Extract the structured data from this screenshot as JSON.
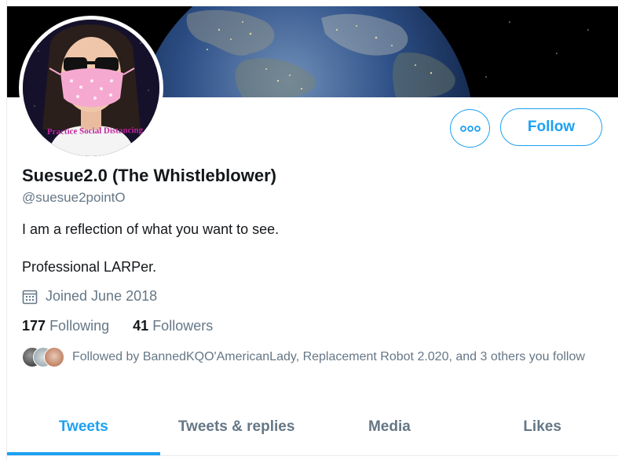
{
  "profile": {
    "name": "Suesue2.0 (The Whistleblower)",
    "handle": "@suesue2pointO",
    "bio_line1": "I am a reflection of what you want to see.",
    "bio_line2": "Professional LARPer.",
    "joined": "Joined June 2018",
    "avatar_caption": "Practice Social Distancing"
  },
  "stats": {
    "following_count": "177",
    "following_label": "Following",
    "followers_count": "41",
    "followers_label": "Followers"
  },
  "followed_by": {
    "text": "Followed by BannedKQO'AmericanLady, Replacement Robot 2.020, and 3 others you follow"
  },
  "actions": {
    "more_icon": "more-horizontal-icon",
    "follow_label": "Follow"
  },
  "tabs": [
    {
      "label": "Tweets",
      "active": true
    },
    {
      "label": "Tweets & replies",
      "active": false
    },
    {
      "label": "Media",
      "active": false
    },
    {
      "label": "Likes",
      "active": false
    }
  ],
  "colors": {
    "accent": "#1da1f2",
    "secondary_text": "#657786",
    "primary_text": "#14171a"
  }
}
